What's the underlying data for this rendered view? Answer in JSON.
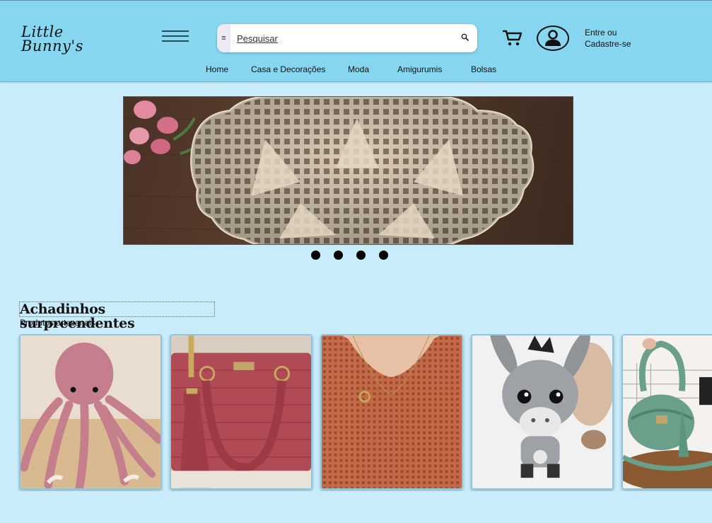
{
  "brand": {
    "logo_line1": "Little",
    "logo_line2": "Bunny's"
  },
  "header": {
    "search_placeholder": "Pesquisar",
    "login_line1": "Entre ou",
    "login_line2": "Cadastre-se"
  },
  "nav": {
    "items": [
      "Home",
      "Casa e Decorações",
      "Moda",
      "Amigurumis",
      "Bolsas"
    ]
  },
  "carousel": {
    "slide_count": 4
  },
  "section": {
    "title": "Achadinhos surpreendentes",
    "subtitle": "Produtos artesanais"
  },
  "colors": {
    "header_bg": "#86d6f0",
    "page_bg": "#c9ecfb",
    "card_border": "#8fc6dc"
  },
  "icons": [
    "menu-icon",
    "search-icon",
    "cart-icon",
    "user-icon"
  ]
}
